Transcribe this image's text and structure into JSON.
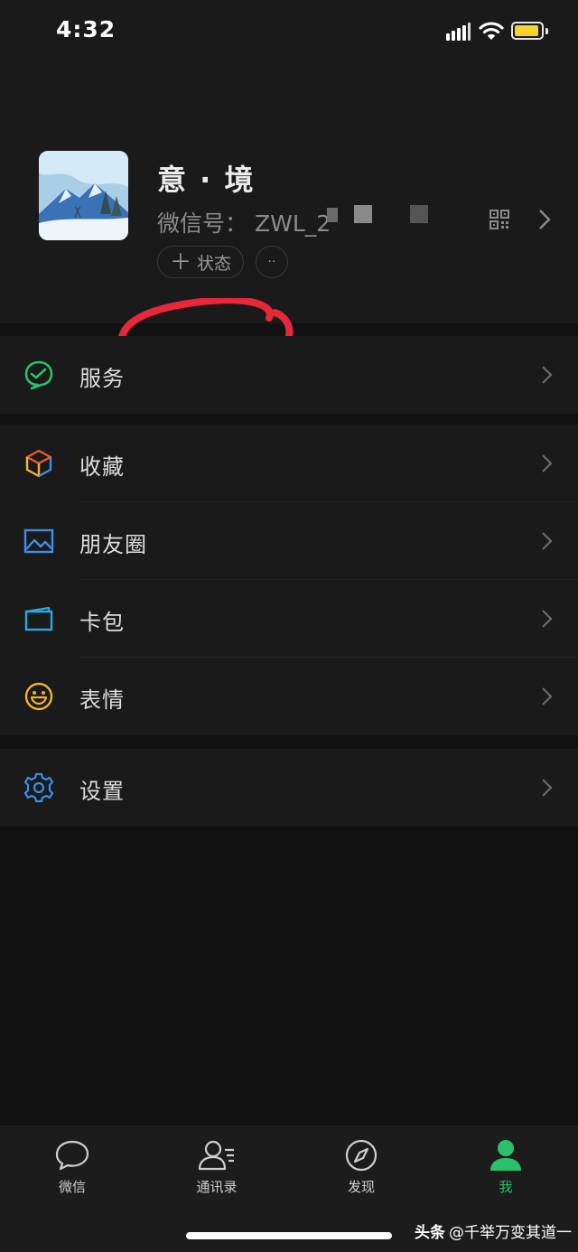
{
  "status_bar": {
    "time": "4:32"
  },
  "profile": {
    "nickname": "意 · 境",
    "wechat_id_label": "微信号：",
    "wechat_id_value": "ZWL_2",
    "status_button_plus": "＋",
    "status_button_label": "状态",
    "more_button": "··"
  },
  "menu": {
    "services": "服务",
    "favorites": "收藏",
    "moments": "朋友圈",
    "card_wallet": "卡包",
    "stickers": "表情",
    "settings": "设置"
  },
  "tabbar": {
    "chats": "微信",
    "contacts": "通讯录",
    "discover": "发现",
    "me": "我"
  },
  "watermark": {
    "brand": "头条",
    "handle": "@千举万变其道一"
  },
  "colors": {
    "accent_green": "#2bc06b",
    "annotation_red": "#e8283a",
    "battery_yellow": "#f4d32a"
  }
}
